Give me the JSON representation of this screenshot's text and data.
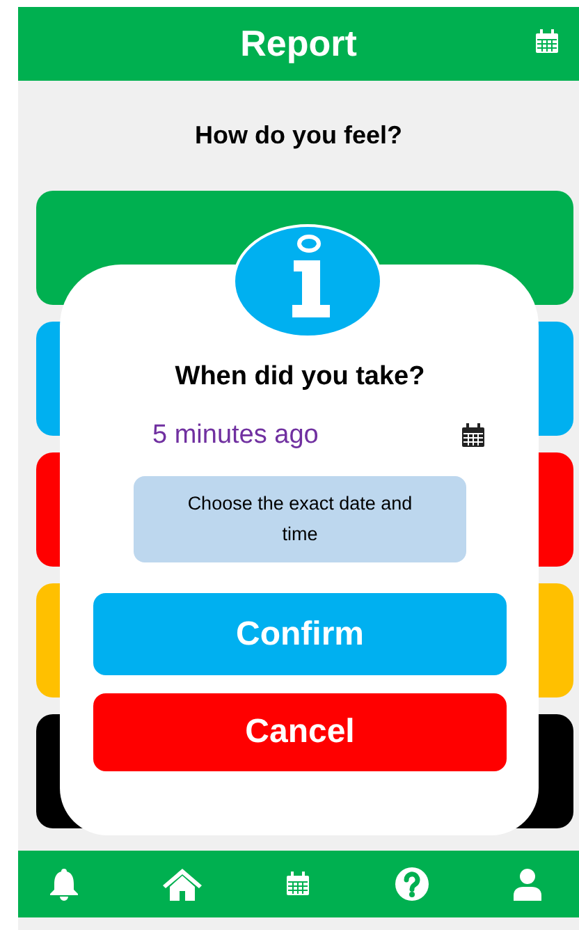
{
  "header": {
    "title": "Report"
  },
  "prompt": "How do you feel?",
  "mood_cards": [
    {
      "color": "#00b050"
    },
    {
      "color": "#00b0f0"
    },
    {
      "color": "#ff0000"
    },
    {
      "color": "#ffc000"
    },
    {
      "color": "#000000"
    }
  ],
  "dialog": {
    "title": "When did you take?",
    "time_value": "5 minutes ago",
    "hint_button": "Choose the exact date and time",
    "buttons": [
      {
        "label": "Confirm",
        "kind": "confirm"
      },
      {
        "label": "Cancel",
        "kind": "cancel"
      }
    ]
  },
  "bottom_nav": [
    {
      "kind": "bell"
    },
    {
      "kind": "home"
    },
    {
      "kind": "calendar"
    },
    {
      "kind": "help"
    },
    {
      "kind": "profile"
    }
  ]
}
